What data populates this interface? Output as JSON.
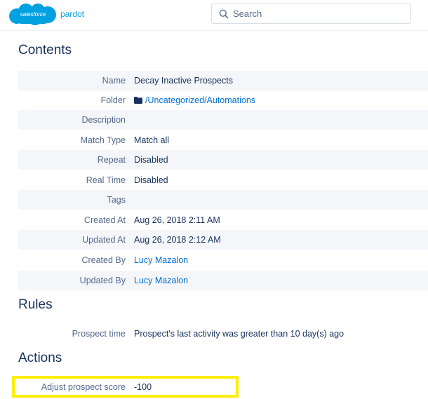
{
  "brand": {
    "cloud_text": "salesforce",
    "product": "pardot",
    "cloud_color": "#00a1e0"
  },
  "search": {
    "placeholder": "Search",
    "icon": "search-icon"
  },
  "contents": {
    "title": "Contents",
    "rows": [
      {
        "label": "Name",
        "value": "Decay Inactive Prospects"
      },
      {
        "label": "Folder",
        "value": "/Uncategorized/Automations",
        "icon": "folder-icon"
      },
      {
        "label": "Description",
        "value": ""
      },
      {
        "label": "Match Type",
        "value": "Match all"
      },
      {
        "label": "Repeat",
        "value": "Disabled"
      },
      {
        "label": "Real Time",
        "value": "Disabled"
      },
      {
        "label": "Tags",
        "value": ""
      },
      {
        "label": "Created At",
        "value": "Aug 26, 2018 2:11 AM"
      },
      {
        "label": "Updated At",
        "value": "Aug 26, 2018 2:12 AM"
      },
      {
        "label": "Created By",
        "value": "Lucy Mazalon"
      },
      {
        "label": "Updated By",
        "value": "Lucy Mazalon"
      }
    ]
  },
  "rules": {
    "title": "Rules",
    "rows": [
      {
        "label": "Prospect time",
        "value": "Prospect's last activity was greater than 10 day(s) ago"
      }
    ]
  },
  "actions": {
    "title": "Actions",
    "rows": [
      {
        "label": "Adjust prospect score",
        "value": "-100"
      }
    ]
  },
  "colors": {
    "link": "#0070d2",
    "row_shade": "#f4f6f9",
    "highlight": "#ffee00",
    "text": "#16325c",
    "label": "#54698d"
  }
}
